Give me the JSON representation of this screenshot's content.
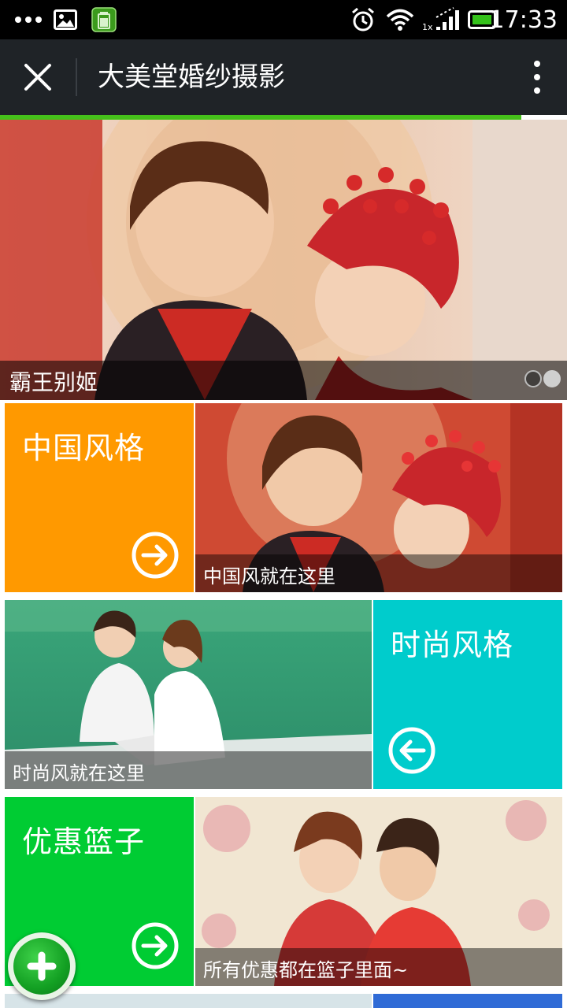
{
  "status_bar": {
    "time": "17:33",
    "icons": [
      "more-dots-icon",
      "gallery-icon",
      "battery-app-icon",
      "alarm-icon",
      "wifi-icon",
      "signal-icon",
      "battery-icon"
    ],
    "signal_label": "1x"
  },
  "title_bar": {
    "title": "大美堂婚纱摄影",
    "close_icon": "close-icon",
    "more_icon": "more-vert-icon"
  },
  "page_load_progress": 0.92,
  "banner": {
    "caption": "霸王别姬",
    "slide_count": 2,
    "active_slide": 2
  },
  "tiles": [
    {
      "id": "chinese-style",
      "title": "中国风格",
      "color": "#ff9900",
      "arrow": "arrow-right-circle-icon"
    },
    {
      "id": "chinese-photo",
      "caption": "中国风就在这里"
    },
    {
      "id": "fashion-photo",
      "caption": "时尚风就在这里"
    },
    {
      "id": "fashion-style",
      "title": "时尚风格",
      "color": "#00cccc",
      "arrow": "arrow-left-circle-icon"
    },
    {
      "id": "discount-basket",
      "title": "优惠篮子",
      "color": "#00cc33",
      "arrow": "arrow-right-circle-icon"
    },
    {
      "id": "discount-photo",
      "caption": "所有优惠都在篮子里面~"
    }
  ],
  "fab": {
    "icon": "plus-icon"
  },
  "colors": {
    "title_bar_bg": "#1f2327",
    "progress_green": "#45c01a",
    "orange": "#ff9900",
    "cyan": "#00cccc",
    "green": "#00cc33"
  }
}
